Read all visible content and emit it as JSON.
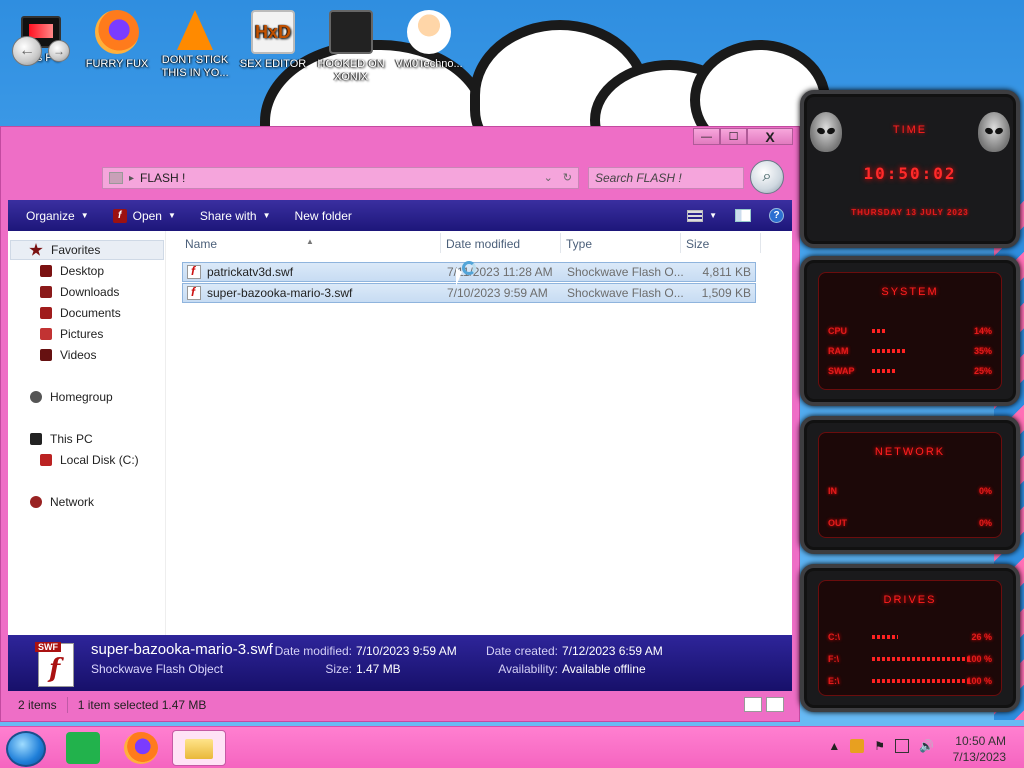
{
  "desktop": {
    "icons": [
      {
        "label": "This PC"
      },
      {
        "label": "FURRY FUX"
      },
      {
        "label": "DONT STICK THIS IN YO..."
      },
      {
        "label": "SEX EDITOR"
      },
      {
        "label": "HOOKED ON XONIX"
      },
      {
        "label": "VM0Techno..."
      }
    ]
  },
  "window": {
    "controls": {
      "minimize": "—",
      "maximize": "☐",
      "close": "X"
    },
    "address": {
      "path": "FLASH !"
    },
    "search": {
      "placeholder": "Search FLASH !"
    },
    "toolbar": {
      "organize": "Organize",
      "open": "Open",
      "share_with": "Share with",
      "new_folder": "New folder"
    },
    "nav_pane": {
      "favorites": "Favorites",
      "desktop": "Desktop",
      "downloads": "Downloads",
      "documents": "Documents",
      "pictures": "Pictures",
      "videos": "Videos",
      "homegroup": "Homegroup",
      "this_pc": "This PC",
      "local_disk": "Local Disk (C:)",
      "network": "Network"
    },
    "columns": {
      "name": "Name",
      "date": "Date modified",
      "type": "Type",
      "size": "Size"
    },
    "files": [
      {
        "name": "patrickatv3d.swf",
        "date": "7/11/2023 11:28 AM",
        "type": "Shockwave Flash O...",
        "size": "4,811 KB"
      },
      {
        "name": "super-bazooka-mario-3.swf",
        "date": "7/10/2023 9:59 AM",
        "type": "Shockwave Flash O...",
        "size": "1,509 KB"
      }
    ],
    "details": {
      "icon_tag": "SWF",
      "name": "super-bazooka-mario-3.swf",
      "type": "Shockwave Flash Object",
      "date_modified_label": "Date modified:",
      "date_modified": "7/10/2023 9:59 AM",
      "size_label": "Size:",
      "size": "1.47 MB",
      "date_created_label": "Date created:",
      "date_created": "7/12/2023 6:59 AM",
      "availability_label": "Availability:",
      "availability": "Available offline"
    },
    "status": {
      "count": "2 items",
      "selection": "1 item selected  1.47 MB"
    }
  },
  "gadgets": {
    "time": {
      "header": "TIME",
      "clock": "10:50:02",
      "date": "THURSDAY 13 JULY 2023"
    },
    "system": {
      "header": "SYSTEM",
      "rows": [
        {
          "label": "CPU",
          "value": "14%",
          "fill": 0.14
        },
        {
          "label": "RAM",
          "value": "35%",
          "fill": 0.35
        },
        {
          "label": "SWAP",
          "value": "25%",
          "fill": 0.25
        }
      ]
    },
    "network": {
      "header": "NETWORK",
      "rows": [
        {
          "label": "IN",
          "value": "0%"
        },
        {
          "label": "OUT",
          "value": "0%"
        }
      ]
    },
    "drives": {
      "header": "DRIVES",
      "rows": [
        {
          "label": "C:\\",
          "value": "26 %",
          "fill": 0.26
        },
        {
          "label": "F:\\",
          "value": "100 %",
          "fill": 1.0
        },
        {
          "label": "E:\\",
          "value": "100 %",
          "fill": 1.0
        }
      ]
    }
  },
  "taskbar": {
    "time": "10:50 AM",
    "date": "7/13/2023"
  }
}
